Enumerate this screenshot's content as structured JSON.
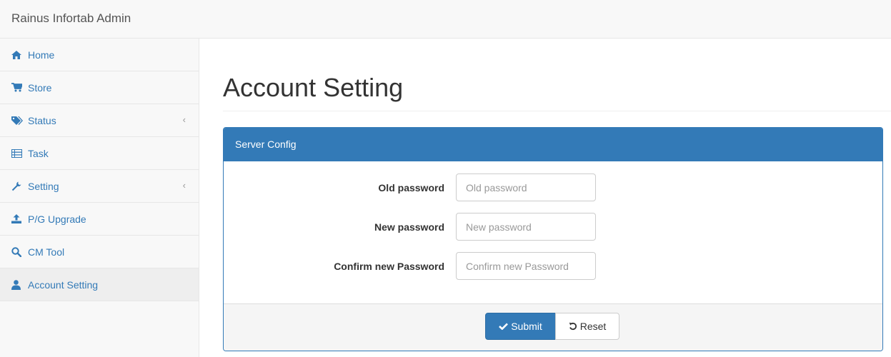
{
  "app": {
    "brand": "Rainus Infortab Admin"
  },
  "sidebar": {
    "items": [
      {
        "label": "Home",
        "icon": "home-icon"
      },
      {
        "label": "Store",
        "icon": "cart-icon"
      },
      {
        "label": "Status",
        "icon": "tags-icon",
        "caret": "‹"
      },
      {
        "label": "Task",
        "icon": "list-icon"
      },
      {
        "label": "Setting",
        "icon": "wrench-icon",
        "caret": "‹"
      },
      {
        "label": "P/G Upgrade",
        "icon": "upload-icon"
      },
      {
        "label": "CM Tool",
        "icon": "search-icon"
      },
      {
        "label": "Account Setting",
        "icon": "user-icon",
        "active": true
      }
    ]
  },
  "main": {
    "title": "Account Setting",
    "panel": {
      "heading": "Server Config",
      "fields": [
        {
          "label": "Old password",
          "placeholder": "Old password"
        },
        {
          "label": "New password",
          "placeholder": "New password"
        },
        {
          "label": "Confirm new Password",
          "placeholder": "Confirm new Password"
        }
      ],
      "submit_label": "Submit",
      "reset_label": "Reset"
    }
  },
  "colors": {
    "primary": "#337ab7",
    "link": "#337ab7",
    "sidebar_bg": "#f8f8f8",
    "active_bg": "#eeeeee"
  }
}
